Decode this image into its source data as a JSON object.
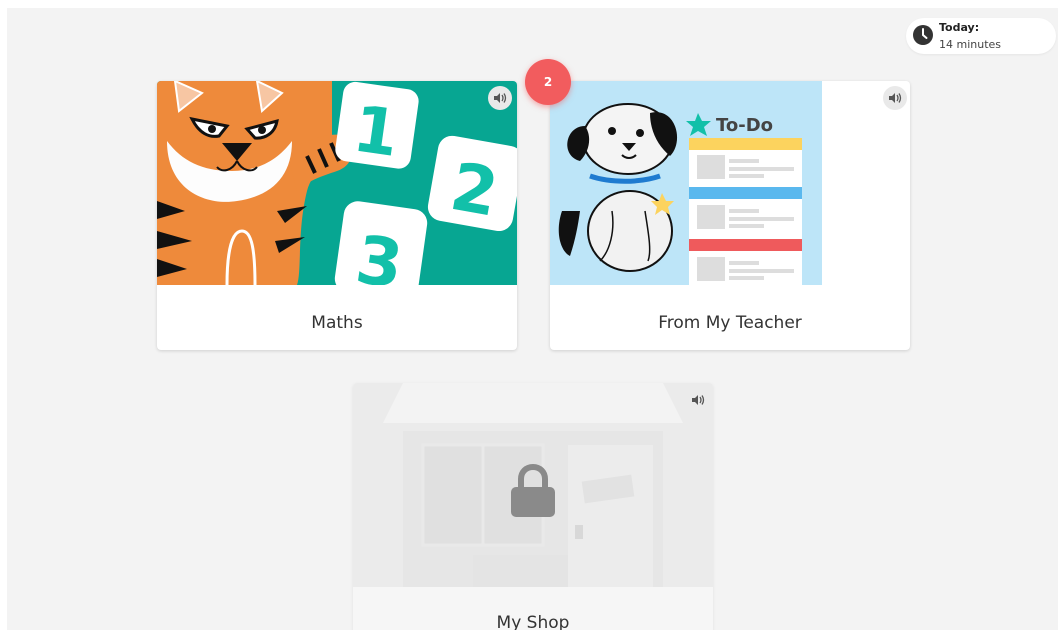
{
  "today": {
    "title": "Today:",
    "value": "14 minutes"
  },
  "notification": {
    "count": "2"
  },
  "cards": [
    {
      "label": "Maths",
      "icon": "speaker-icon",
      "locked": false
    },
    {
      "label": "From My Teacher",
      "icon": "speaker-icon",
      "locked": false
    },
    {
      "label": "My Shop",
      "icon": "speaker-icon",
      "locked": true
    }
  ],
  "todo_illustration": {
    "heading": "To-Do"
  },
  "maths_illustration": {
    "numbers": [
      "1",
      "2",
      "3"
    ]
  },
  "colors": {
    "maths_bg": "#07a692",
    "teacher_bg": "#bde5f8",
    "badge": "#f25c5e",
    "tiger": "#ee8a3b",
    "number_text": "#12c0a9"
  }
}
